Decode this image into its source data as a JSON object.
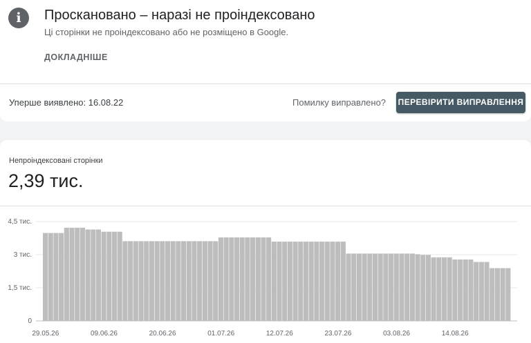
{
  "header": {
    "icon": "info-icon",
    "title": "Проскановано – наразі не проіндексовано",
    "subtitle": "Ці сторінки не проіндексовано або не розміщено в Google.",
    "more_link": "ДОКЛАДНІШЕ"
  },
  "status": {
    "first_found": "Уперше виявлено: 16.08.22",
    "fixed_question": "Помилку виправлено?",
    "validate_button": "ПЕРЕВІРИТИ ВИПРАВЛЕННЯ"
  },
  "metric": {
    "label": "Непроіндексовані сторінки",
    "value": "2,39 тис."
  },
  "colors": {
    "bar": "#bdbdbd",
    "button": "#455a64",
    "gridline": "#e8eaed"
  },
  "chart_data": {
    "type": "bar",
    "ylim": [
      0,
      4500
    ],
    "y_ticks": [
      {
        "value": 0,
        "label": "0"
      },
      {
        "value": 1500,
        "label": "1,5 тис."
      },
      {
        "value": 3000,
        "label": "3 тис."
      },
      {
        "value": 4500,
        "label": "4,5 тис."
      }
    ],
    "x_tick_labels": [
      "29.05.26",
      "09.06.26",
      "20.06.26",
      "01.07.26",
      "12.07.26",
      "23.07.26",
      "03.08.26",
      "14.08.26"
    ],
    "x_tick_bar_index": [
      0,
      11,
      22,
      33,
      44,
      55,
      66,
      77
    ],
    "values": [
      3980,
      3980,
      3980,
      3980,
      4220,
      4220,
      4220,
      4220,
      4140,
      4140,
      4140,
      4040,
      4040,
      4040,
      4040,
      3610,
      3610,
      3610,
      3610,
      3610,
      3610,
      3610,
      3610,
      3610,
      3610,
      3610,
      3610,
      3610,
      3610,
      3610,
      3610,
      3610,
      3610,
      3780,
      3780,
      3780,
      3780,
      3780,
      3780,
      3780,
      3780,
      3780,
      3780,
      3590,
      3590,
      3590,
      3590,
      3590,
      3590,
      3590,
      3590,
      3590,
      3590,
      3590,
      3590,
      3590,
      3590,
      3050,
      3050,
      3050,
      3050,
      3050,
      3050,
      3050,
      3050,
      3050,
      3050,
      3050,
      3050,
      3050,
      3020,
      2990,
      2990,
      2880,
      2880,
      2880,
      2880,
      2780,
      2780,
      2780,
      2780,
      2670,
      2670,
      2670,
      2390,
      2390,
      2390,
      2390
    ]
  }
}
